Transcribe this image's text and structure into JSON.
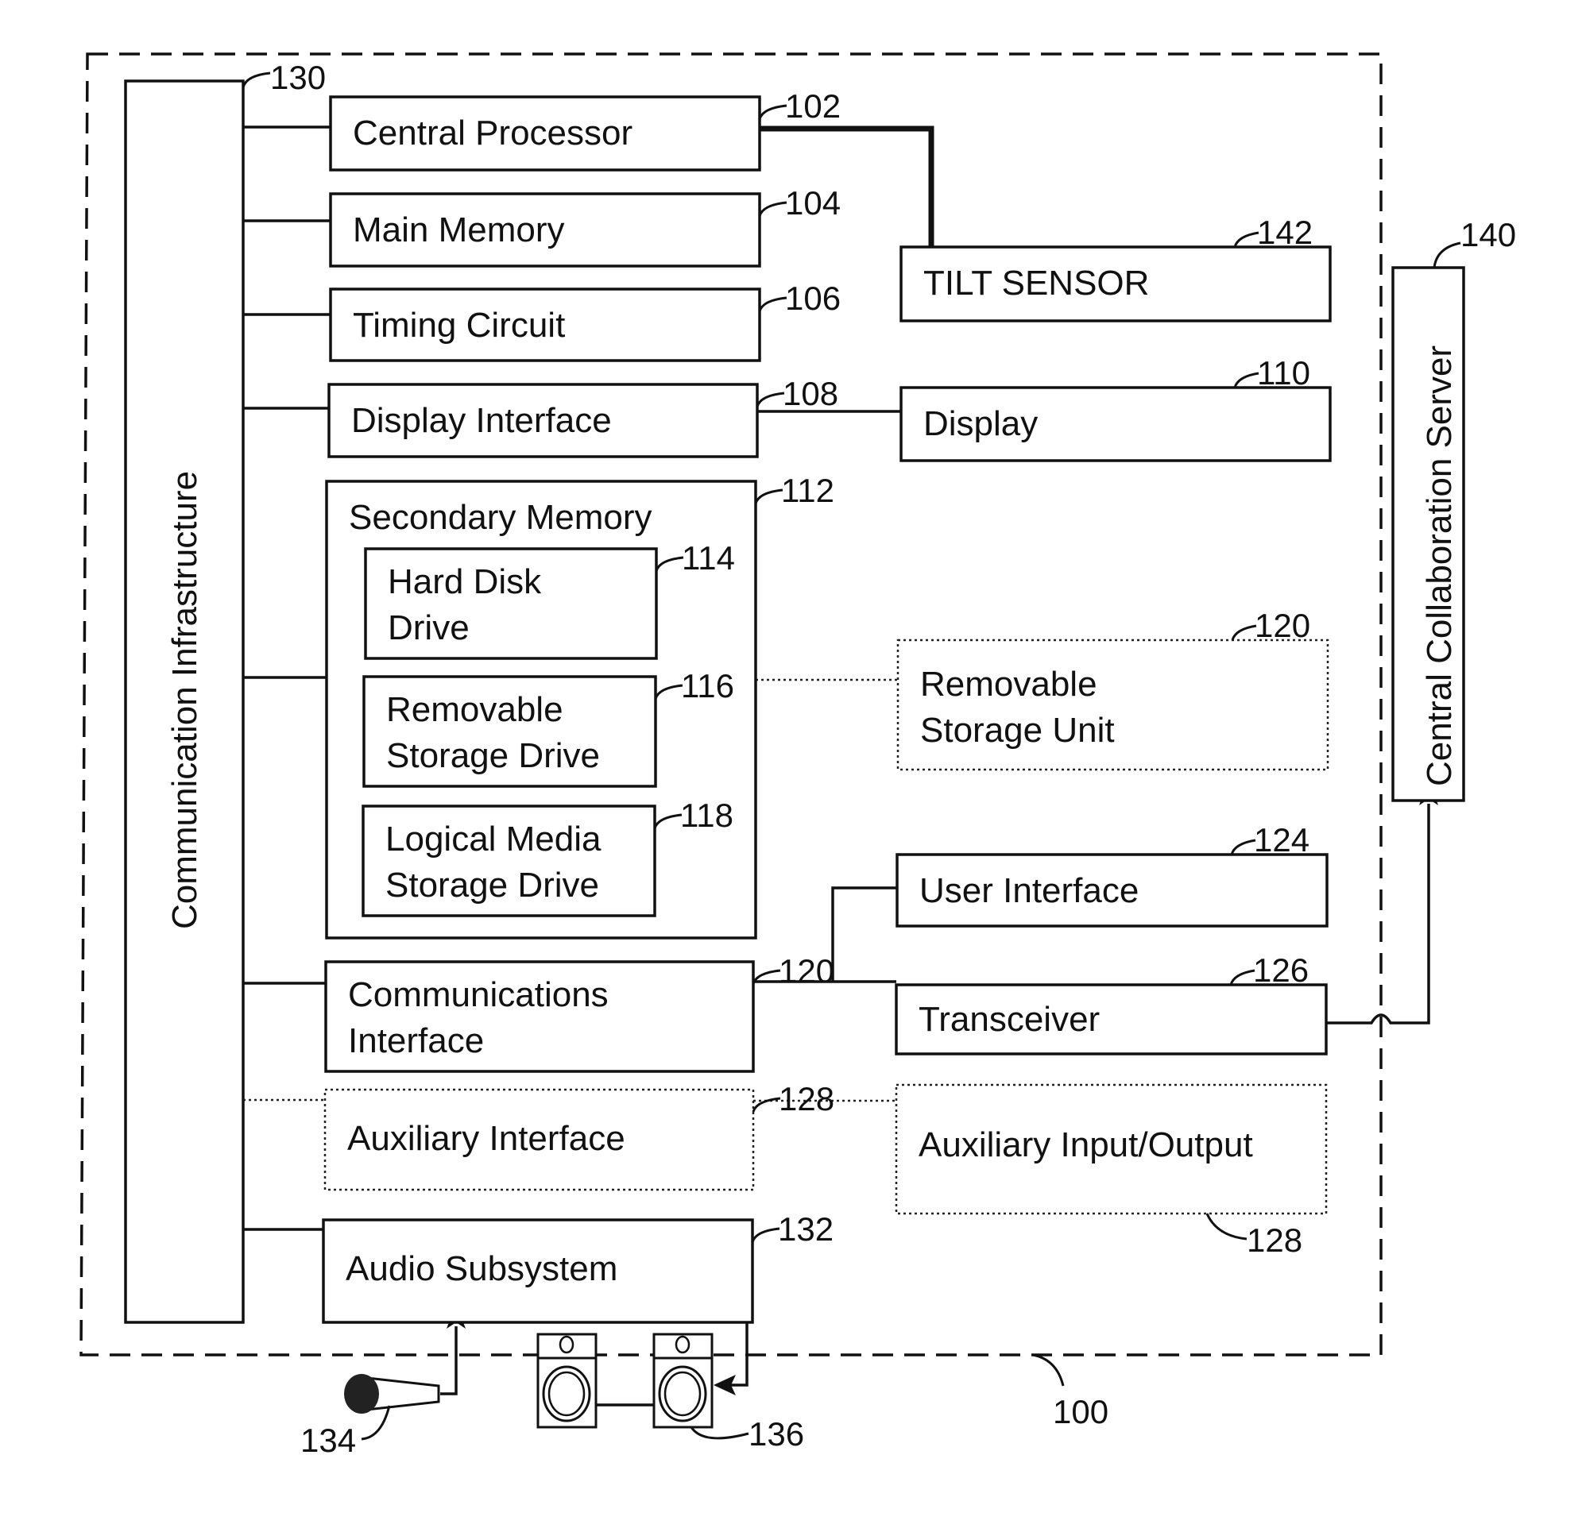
{
  "figure": {
    "system_ref": "100",
    "outer_boundary": "dashed"
  },
  "bus": {
    "label": "Communication Infrastructure",
    "ref": "130"
  },
  "blocks": [
    {
      "id": "central-processor",
      "lines": [
        "Central Processor"
      ],
      "ref": "102",
      "style": "solid"
    },
    {
      "id": "main-memory",
      "lines": [
        "Main Memory"
      ],
      "ref": "104",
      "style": "solid"
    },
    {
      "id": "timing-circuit",
      "lines": [
        "Timing Circuit"
      ],
      "ref": "106",
      "style": "solid"
    },
    {
      "id": "display-interface",
      "lines": [
        "Display Interface"
      ],
      "ref": "108",
      "style": "solid"
    },
    {
      "id": "secondary-memory",
      "lines": [
        "Secondary Memory"
      ],
      "ref": "112",
      "style": "solid"
    },
    {
      "id": "hard-disk-drive",
      "lines": [
        "Hard Disk",
        "Drive"
      ],
      "ref": "114",
      "style": "solid"
    },
    {
      "id": "removable-storage-drive",
      "lines": [
        "Removable",
        "Storage Drive"
      ],
      "ref": "116",
      "style": "solid"
    },
    {
      "id": "logical-media-storage-drive",
      "lines": [
        "Logical Media",
        "Storage Drive"
      ],
      "ref": "118",
      "style": "solid"
    },
    {
      "id": "communications-interface",
      "lines": [
        "Communications",
        "Interface"
      ],
      "ref": "120",
      "style": "solid"
    },
    {
      "id": "auxiliary-interface",
      "lines": [
        "Auxiliary Interface"
      ],
      "ref": "128",
      "style": "dotted"
    },
    {
      "id": "audio-subsystem",
      "lines": [
        "Audio Subsystem"
      ],
      "ref": "132",
      "style": "solid"
    },
    {
      "id": "tilt-sensor",
      "lines": [
        "TILT SENSOR"
      ],
      "ref": "142",
      "style": "solid"
    },
    {
      "id": "display",
      "lines": [
        "Display"
      ],
      "ref": "110",
      "style": "solid"
    },
    {
      "id": "removable-storage-unit",
      "lines": [
        "Removable",
        "Storage Unit"
      ],
      "ref": "120",
      "style": "dotted"
    },
    {
      "id": "user-interface",
      "lines": [
        "User Interface"
      ],
      "ref": "124",
      "style": "solid"
    },
    {
      "id": "transceiver",
      "lines": [
        "Transceiver"
      ],
      "ref": "126",
      "style": "solid"
    },
    {
      "id": "auxiliary-input-output",
      "lines": [
        "Auxiliary Input/Output"
      ],
      "ref": "128",
      "style": "dotted"
    }
  ],
  "server": {
    "label": "Central Collaboration Server",
    "ref": "140"
  },
  "peripherals": {
    "microphone": {
      "ref": "134",
      "icon": "microphone-icon"
    },
    "speakers": {
      "ref": "136",
      "icon": "speaker-icon"
    }
  }
}
